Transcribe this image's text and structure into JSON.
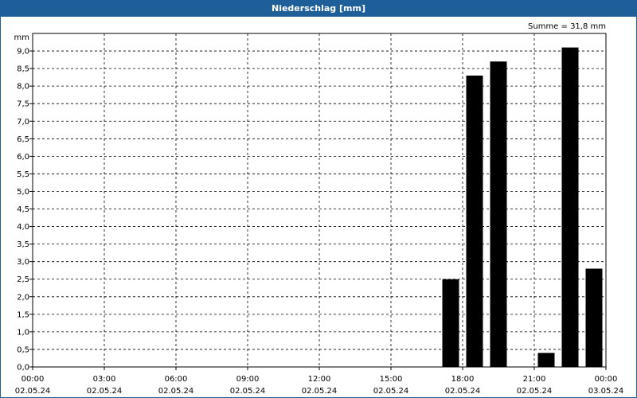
{
  "title": "Niederschlag [mm]",
  "chart_data": {
    "type": "bar",
    "title": "Niederschlag [mm]",
    "ylabel": "mm",
    "annotation": "Summe = 31,8 mm",
    "ylim": [
      0,
      9.5
    ],
    "y_ticks": [
      "0,0",
      "0,5",
      "1,0",
      "1,5",
      "2,0",
      "2,5",
      "3,0",
      "3,5",
      "4,0",
      "4,5",
      "5,0",
      "5,5",
      "6,0",
      "6,5",
      "7,0",
      "7,5",
      "8,0",
      "8,5",
      "9,0"
    ],
    "x_ticks": [
      {
        "time": "00:00",
        "date": "02.05.24"
      },
      {
        "time": "03:00",
        "date": "02.05.24"
      },
      {
        "time": "06:00",
        "date": "02.05.24"
      },
      {
        "time": "09:00",
        "date": "02.05.24"
      },
      {
        "time": "12:00",
        "date": "02.05.24"
      },
      {
        "time": "15:00",
        "date": "02.05.24"
      },
      {
        "time": "18:00",
        "date": "02.05.24"
      },
      {
        "time": "21:00",
        "date": "02.05.24"
      },
      {
        "time": "00:00",
        "date": "03.05.24"
      }
    ],
    "bars": [
      {
        "time": "17:00",
        "value": 2.5
      },
      {
        "time": "18:00",
        "value": 8.3
      },
      {
        "time": "19:00",
        "value": 8.7
      },
      {
        "time": "21:00",
        "value": 0.4
      },
      {
        "time": "22:00",
        "value": 9.1
      },
      {
        "time": "23:00",
        "value": 2.8
      }
    ],
    "grid": true,
    "colors": {
      "bar": "#000000",
      "title_bg": "#1f5f99",
      "title_text": "#ffffff"
    }
  }
}
